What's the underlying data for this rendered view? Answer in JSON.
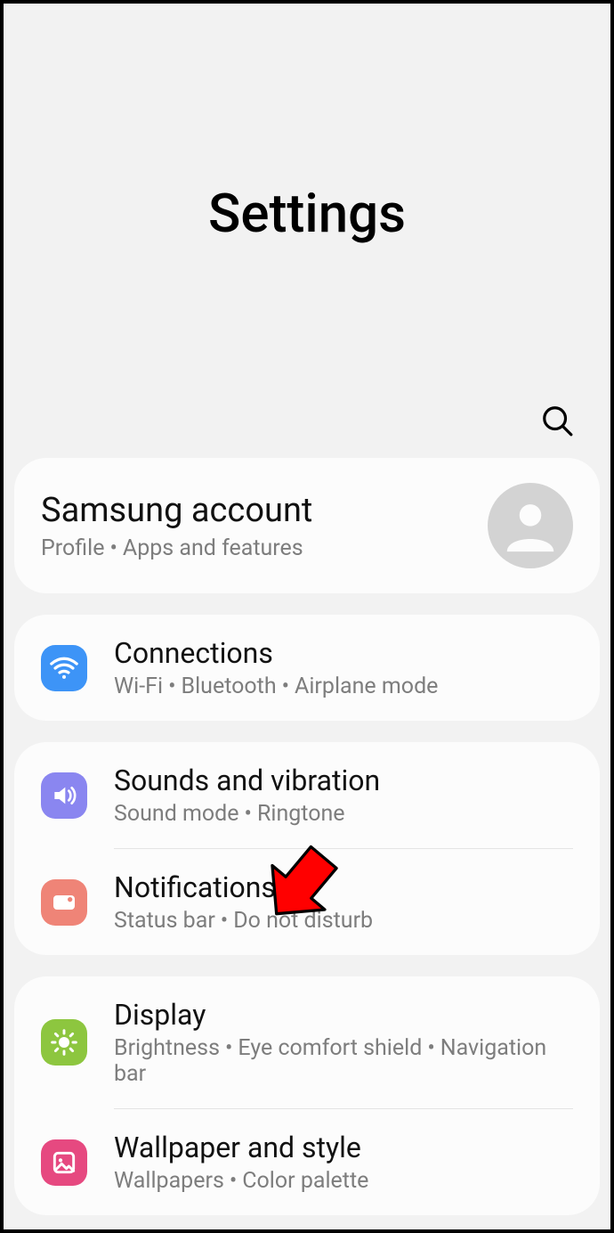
{
  "page": {
    "title": "Settings"
  },
  "account": {
    "title": "Samsung account",
    "sub1": "Profile",
    "sub2": "Apps and features"
  },
  "groups": [
    {
      "items": [
        {
          "key": "connections",
          "title": "Connections",
          "subs": [
            "Wi-Fi",
            "Bluetooth",
            "Airplane mode"
          ],
          "iconClass": "ic-wifi"
        }
      ]
    },
    {
      "items": [
        {
          "key": "sounds",
          "title": "Sounds and vibration",
          "subs": [
            "Sound mode",
            "Ringtone"
          ],
          "iconClass": "ic-sound"
        },
        {
          "key": "notifications",
          "title": "Notifications",
          "subs": [
            "Status bar",
            "Do not disturb"
          ],
          "iconClass": "ic-notif"
        }
      ]
    },
    {
      "items": [
        {
          "key": "display",
          "title": "Display",
          "subs": [
            "Brightness",
            "Eye comfort shield",
            "Navigation bar"
          ],
          "iconClass": "ic-display"
        },
        {
          "key": "wallpaper",
          "title": "Wallpaper and style",
          "subs": [
            "Wallpapers",
            "Color palette"
          ],
          "iconClass": "ic-wallpaper"
        }
      ]
    }
  ]
}
